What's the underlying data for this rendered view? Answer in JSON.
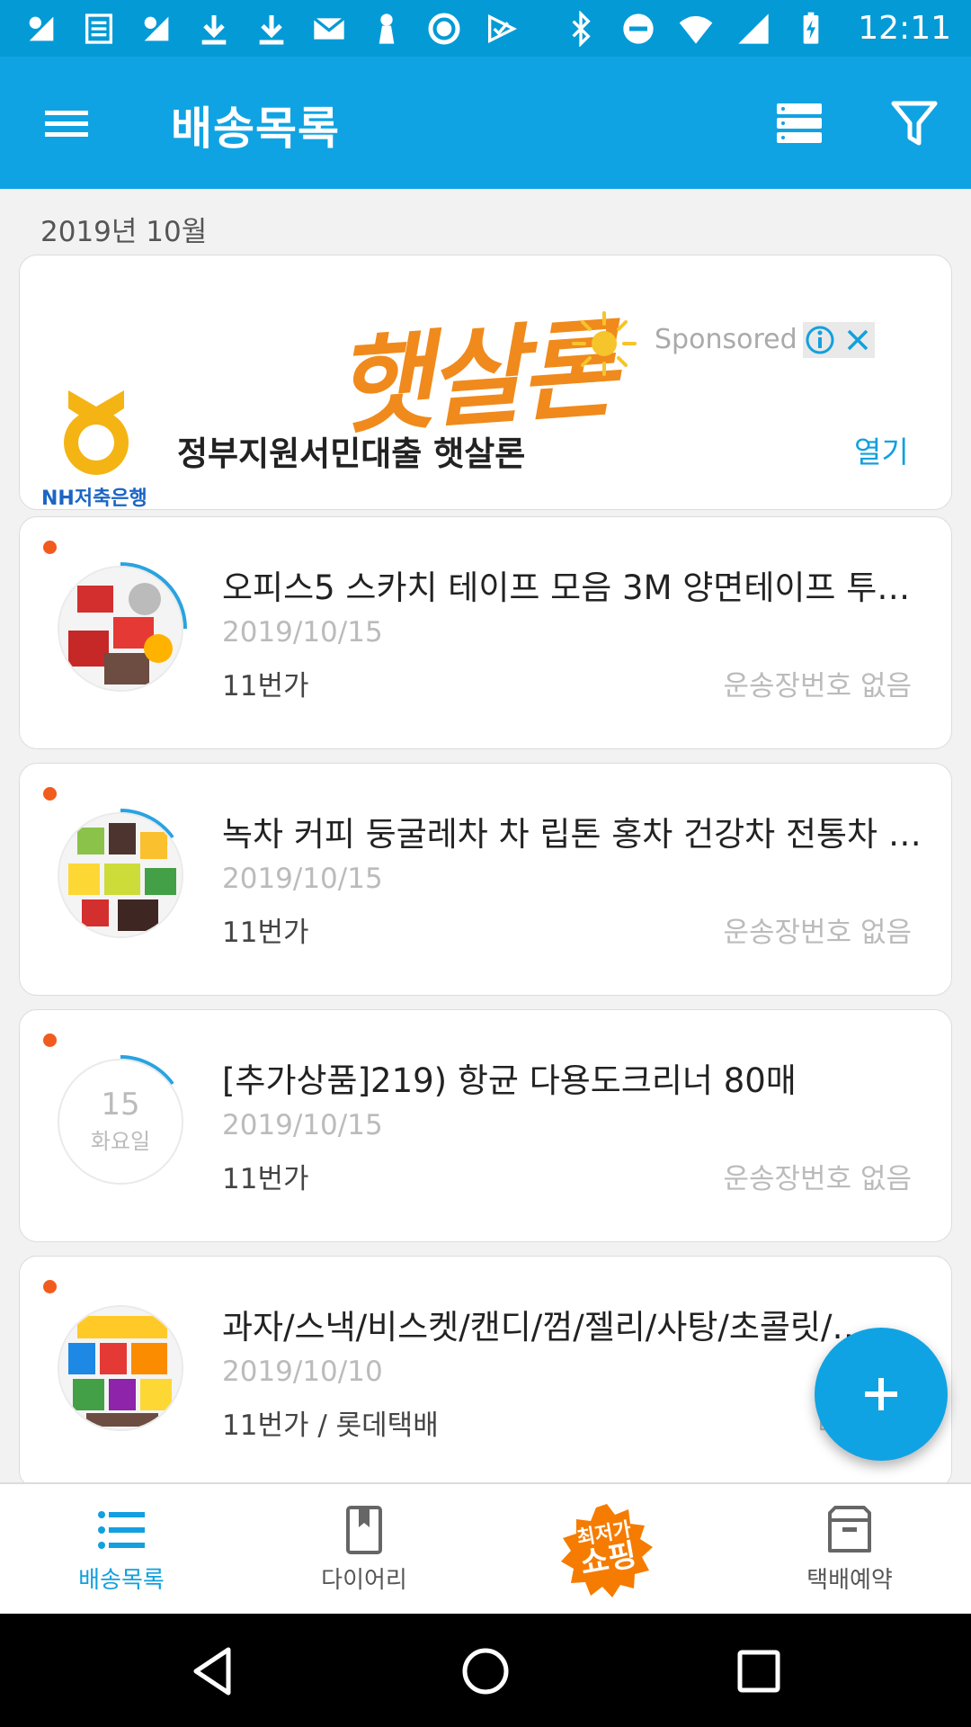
{
  "status_bar": {
    "time": "12:11",
    "left_icons": [
      "wifi-key-icon",
      "news-icon",
      "wifi-key-icon",
      "download-icon",
      "download-icon",
      "mail-icon",
      "keyhole-icon",
      "record-icon",
      "check-flag-icon"
    ],
    "right_icons": [
      "bluetooth-icon",
      "do-not-disturb-icon",
      "wifi-icon",
      "signal-icon",
      "battery-charging-icon"
    ]
  },
  "appbar": {
    "title": "배송목록",
    "icons": [
      "menu-icon",
      "list-view-icon",
      "filter-icon"
    ]
  },
  "month_label": "2019년 10월",
  "ad": {
    "brand_logo_text": "햇살론",
    "sponsored": "Sponsored",
    "bank_text": "NH저축은행",
    "headline": "정부지원서민대출 햇살론",
    "open_label": "열기"
  },
  "deliveries": [
    {
      "title": "오피스5 스카치 테이프 모음 3M 양면테이프 투명테이프",
      "date": "2019/10/15",
      "shop": "11번가",
      "status": "운송장번호 없음"
    },
    {
      "title": "녹차 커피 둥굴레차 차 립톤 홍차 건강차 전통차 모음",
      "date": "2019/10/15",
      "shop": "11번가",
      "status": "운송장번호 없음"
    },
    {
      "title": "[추가상품]219) 항균 다용도크리너 80매",
      "date": "2019/10/15",
      "shop": "11번가",
      "status": "운송장번호 없음",
      "day": "15",
      "weekday": "화요일"
    },
    {
      "title": "과자/스낵/비스켓/캔디/껌/젤리/사탕/초콜릿/간식",
      "date": "2019/10/10",
      "shop": "11번가 / 롯데택배",
      "status": "배"
    }
  ],
  "bottom_nav": {
    "items": [
      {
        "label": "배송목록",
        "icon": "list-icon"
      },
      {
        "label": "다이어리",
        "icon": "bookmark-book-icon"
      },
      {
        "label": "",
        "icon": "shopping-badge-icon"
      },
      {
        "label": "택배예약",
        "icon": "box-icon"
      }
    ],
    "shop_badge_line1": "최저가",
    "shop_badge_line2": "쇼핑"
  },
  "colors": {
    "primary": "#10a3e3",
    "status_bar": "#039ad6",
    "accent_dot": "#f25b1e",
    "ad_orange": "#f08a1c"
  }
}
